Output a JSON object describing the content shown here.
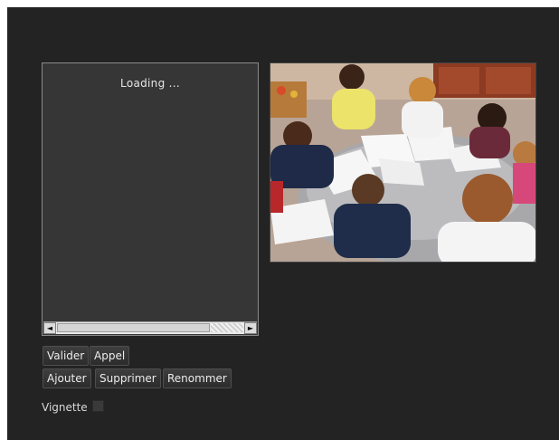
{
  "list_panel": {
    "loading_text": "Loading ..."
  },
  "photo": {
    "description_icon": "classroom-photo"
  },
  "buttons": {
    "validate": "Valider",
    "call": "Appel",
    "add": "Ajouter",
    "delete": "Supprimer",
    "rename": "Renommer"
  },
  "vignette": {
    "label": "Vignette",
    "checked": false
  },
  "scrollbar": {
    "left_arrow": "◄",
    "right_arrow": "►"
  }
}
